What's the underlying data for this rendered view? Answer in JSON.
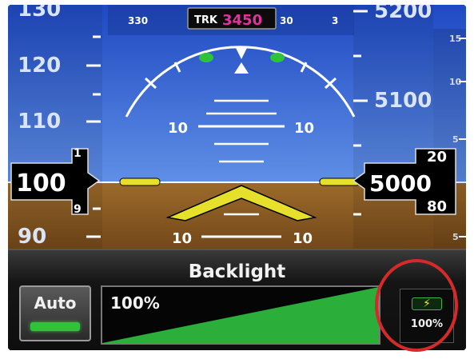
{
  "pfd": {
    "track": {
      "label": "TRK",
      "value": "3450"
    },
    "heading_ticks": [
      "330",
      "30",
      "3"
    ],
    "airspeed": {
      "tape": [
        "130",
        "120",
        "110",
        "90"
      ],
      "current": "100",
      "roll_above": "1",
      "roll_below": "9"
    },
    "altitude": {
      "tape": [
        "5200",
        "5100"
      ],
      "current": "5000",
      "roll_above": "20",
      "roll_below": "80"
    },
    "vsi_ticks": [
      "15",
      "10",
      "5",
      "5"
    ],
    "pitch_labels": {
      "up_left": "10",
      "up_right": "10",
      "down_left": "10",
      "down_right": "10"
    }
  },
  "backlight": {
    "title": "Backlight",
    "auto_label": "Auto",
    "level_label": "100%",
    "level": 1.0,
    "photocell_value": "100%"
  },
  "colors": {
    "sky": "#2f5fd0",
    "ground": "#8a5a22",
    "accent_green": "#2fc23a",
    "track_magenta": "#e5319f",
    "highlight_red": "#d42a2a"
  }
}
